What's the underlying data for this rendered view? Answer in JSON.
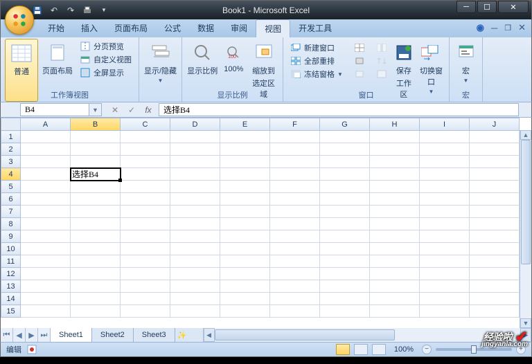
{
  "window": {
    "title": "Book1 - Microsoft Excel"
  },
  "tabs": {
    "items": [
      "开始",
      "插入",
      "页面布局",
      "公式",
      "数据",
      "审阅",
      "视图",
      "开发工具"
    ],
    "active_index": 6
  },
  "ribbon": {
    "groups": {
      "workbook_views": {
        "label": "工作簿视图",
        "normal": "普通",
        "page_layout": "页面布局",
        "page_break": "分页预览",
        "custom_views": "自定义视图",
        "full_screen": "全屏显示"
      },
      "show_hide": {
        "label": "显示/隐藏"
      },
      "zoom": {
        "label": "显示比例",
        "zoom": "显示比例",
        "hundred": "100%",
        "to_selection_l1": "缩放到",
        "to_selection_l2": "选定区域"
      },
      "window_group": {
        "label": "窗口",
        "new_window": "新建窗口",
        "arrange_all": "全部重排",
        "freeze": "冻结窗格",
        "save_ws_l1": "保存",
        "save_ws_l2": "工作区",
        "switch_l1": "切换窗口"
      },
      "macros": {
        "label": "宏",
        "btn": "宏"
      }
    }
  },
  "formula_bar": {
    "name_box": "B4",
    "formula": "选择B4"
  },
  "grid": {
    "columns": [
      "A",
      "B",
      "C",
      "D",
      "E",
      "F",
      "G",
      "H",
      "I",
      "J"
    ],
    "rows": 15,
    "active_cell": {
      "row": 4,
      "col": "B"
    },
    "active_cell_value": "选择B4"
  },
  "sheets": {
    "items": [
      "Sheet1",
      "Sheet2",
      "Sheet3"
    ],
    "active_index": 0
  },
  "status": {
    "mode": "编辑",
    "zoom": "100%"
  },
  "watermark": {
    "text1": "经验啦",
    "text2": "jingyanla.com"
  }
}
